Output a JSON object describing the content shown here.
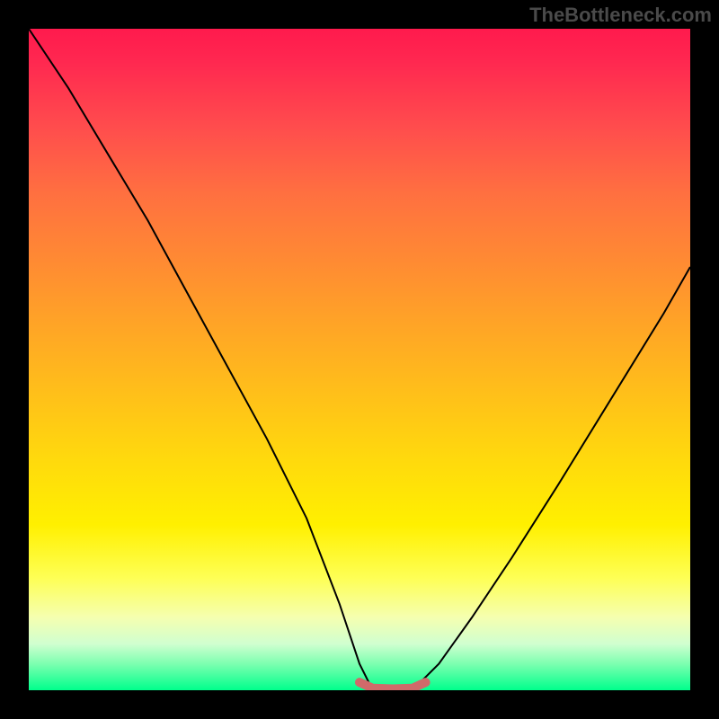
{
  "watermark": "TheBottleneck.com",
  "chart_data": {
    "type": "line",
    "title": "",
    "xlabel": "",
    "ylabel": "",
    "xlim": [
      0,
      100
    ],
    "ylim": [
      0,
      100
    ],
    "gradient_stops": [
      {
        "pos": 0,
        "color": "#ff1a4d"
      },
      {
        "pos": 15,
        "color": "#ff4d4d"
      },
      {
        "pos": 35,
        "color": "#ff8a33"
      },
      {
        "pos": 55,
        "color": "#ffbf1a"
      },
      {
        "pos": 75,
        "color": "#fff000"
      },
      {
        "pos": 89,
        "color": "#f5ffb0"
      },
      {
        "pos": 100,
        "color": "#00ff8c"
      }
    ],
    "series": [
      {
        "name": "left-curve",
        "x": [
          0,
          6,
          12,
          18,
          24,
          30,
          36,
          42,
          47,
          50,
          52
        ],
        "y": [
          100,
          91,
          81,
          71,
          60,
          49,
          38,
          26,
          13,
          4,
          0
        ]
      },
      {
        "name": "valley-highlight",
        "x": [
          50,
          52,
          55,
          58,
          60
        ],
        "y": [
          1.2,
          0.3,
          0.2,
          0.3,
          1.2
        ],
        "color": "#d06a6a",
        "stroke_width": 6
      },
      {
        "name": "right-curve",
        "x": [
          58,
          62,
          67,
          73,
          80,
          88,
          96,
          100
        ],
        "y": [
          0,
          4,
          11,
          20,
          31,
          44,
          57,
          64
        ]
      }
    ],
    "annotations": []
  }
}
